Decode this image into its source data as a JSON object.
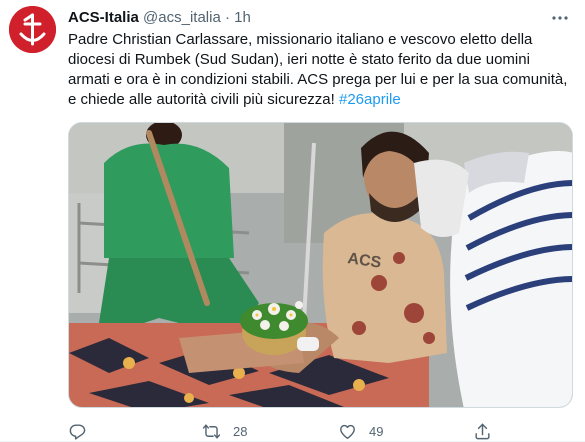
{
  "tweet": {
    "author_name": "ACS-Italia",
    "author_handle": "@acs_italia",
    "separator": "·",
    "time": "1h",
    "text_lines": [
      "Padre Christian Carlassare, missionario italiano e vescovo eletto della",
      "diocesi di Rumbek (Sud Sudan), ieri notte è stato ferito da due uomini",
      "armati e ora è in condizioni stabili. ACS prega per lui e per la sua comunità,",
      "e chiede alle autorità civili più sicurezza!"
    ],
    "hashtag": "#26aprile",
    "media_alt": "photo",
    "photo_shirt_text": "ACS"
  },
  "actions": {
    "reply_icon": "reply-icon",
    "retweet_icon": "retweet-icon",
    "retweet_count": "28",
    "like_icon": "like-icon",
    "like_count": "49",
    "share_icon": "share-icon"
  },
  "colors": {
    "brand_red": "#d0202b",
    "link_blue": "#1d9bf0",
    "muted_text": "#536471"
  }
}
